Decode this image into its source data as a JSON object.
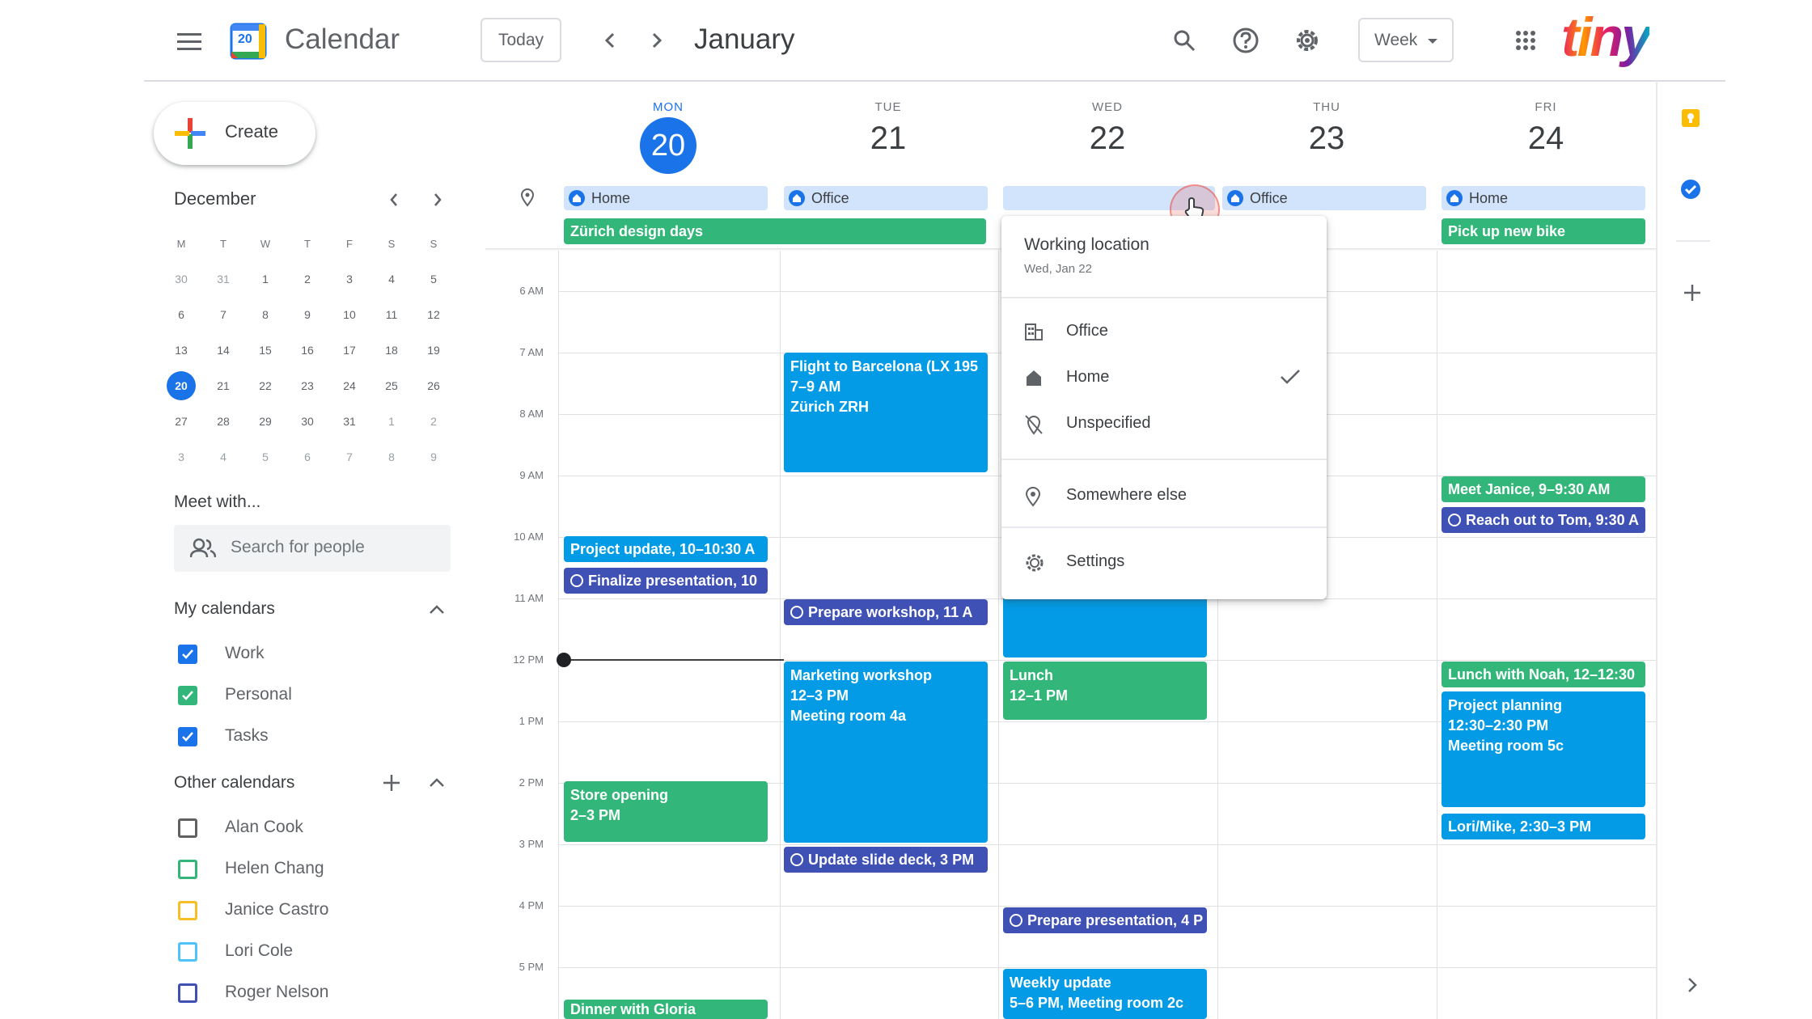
{
  "header": {
    "app_title": "Calendar",
    "logo_day": "20",
    "today_label": "Today",
    "month_title": "January",
    "view_label": "Week",
    "brand_logo": "tiny"
  },
  "sidebar": {
    "create_label": "Create",
    "mini_calendar": {
      "month": "December",
      "weekday_headers": [
        "M",
        "T",
        "W",
        "T",
        "F",
        "S",
        "S"
      ],
      "weeks": [
        [
          "30",
          "31",
          "1",
          "2",
          "3",
          "4",
          "5"
        ],
        [
          "6",
          "7",
          "8",
          "9",
          "10",
          "11",
          "12"
        ],
        [
          "13",
          "14",
          "15",
          "16",
          "17",
          "18",
          "19"
        ],
        [
          "20",
          "21",
          "22",
          "23",
          "24",
          "25",
          "26"
        ],
        [
          "27",
          "28",
          "29",
          "30",
          "31",
          "1",
          "2"
        ],
        [
          "3",
          "4",
          "5",
          "6",
          "7",
          "8",
          "9"
        ]
      ],
      "selected_day": "20"
    },
    "meet_with_title": "Meet with...",
    "search_people_placeholder": "Search for people",
    "my_calendars_title": "My calendars",
    "my_calendars": [
      {
        "name": "Work",
        "color": "#1a73e8",
        "checked": true
      },
      {
        "name": "Personal",
        "color": "#33b679",
        "checked": true
      },
      {
        "name": "Tasks",
        "color": "#1a73e8",
        "checked": true
      }
    ],
    "other_calendars_title": "Other calendars",
    "other_calendars": [
      {
        "name": "Alan Cook",
        "color": "#616161",
        "checked": false
      },
      {
        "name": "Helen Chang",
        "color": "#33b679",
        "checked": false
      },
      {
        "name": "Janice Castro",
        "color": "#f6bf26",
        "checked": false
      },
      {
        "name": "Lori Cole",
        "color": "#4fc3f7",
        "checked": false
      },
      {
        "name": "Roger Nelson",
        "color": "#3f51b5",
        "checked": false
      }
    ]
  },
  "week": {
    "days": [
      {
        "abbr": "MON",
        "num": "20",
        "today": true,
        "location": "Home"
      },
      {
        "abbr": "TUE",
        "num": "21",
        "today": false,
        "location": "Office"
      },
      {
        "abbr": "WED",
        "num": "22",
        "today": false,
        "location": ""
      },
      {
        "abbr": "THU",
        "num": "23",
        "today": false,
        "location": "Office"
      },
      {
        "abbr": "FRI",
        "num": "24",
        "today": false,
        "location": "Home"
      }
    ],
    "all_day_events": [
      {
        "title": "Zürich design days",
        "color": "#33b679"
      },
      {
        "title": "Pick up new bike",
        "color": "#33b679"
      }
    ],
    "time_labels": [
      "6 AM",
      "7 AM",
      "8 AM",
      "9 AM",
      "10 AM",
      "11 AM",
      "12 PM",
      "1 PM",
      "2 PM",
      "3 PM",
      "4 PM",
      "5 PM"
    ],
    "events": {
      "flight": {
        "title": "Flight to Barcelona (LX 195",
        "time": "7–9 AM",
        "place": "Zürich ZRH"
      },
      "project_update": {
        "title": "Project update, 10–10:30 A"
      },
      "finalize_presentation": {
        "title": "Finalize presentation, 10"
      },
      "prepare_workshop": {
        "title": "Prepare workshop, 11 A"
      },
      "marketing_workshop": {
        "title": "Marketing workshop",
        "time": "12–3 PM",
        "place": "Meeting room 4a"
      },
      "lunch": {
        "title": "Lunch",
        "time": "12–1 PM"
      },
      "store_opening": {
        "title": "Store opening",
        "time": "2–3 PM"
      },
      "update_slide_deck": {
        "title": "Update slide deck, 3 PM"
      },
      "prepare_presentation": {
        "title": "Prepare presentation, 4 P"
      },
      "weekly_update": {
        "title": "Weekly update",
        "time": "5–6 PM, Meeting room 2c"
      },
      "dinner": {
        "title": "Dinner with Gloria"
      },
      "meet_janice": {
        "title": "Meet Janice, 9–9:30 AM"
      },
      "reach_out_tom": {
        "title": "Reach out to Tom, 9:30 A"
      },
      "lunch_noah": {
        "title": "Lunch with Noah, 12–12:30"
      },
      "project_planning": {
        "title": "Project planning",
        "time": "12:30–2:30 PM",
        "place": "Meeting room 5c"
      },
      "lori_mike": {
        "title": "Lori/Mike, 2:30–3 PM"
      }
    }
  },
  "popup": {
    "title": "Working location",
    "date": "Wed, Jan 22",
    "options": [
      "Office",
      "Home",
      "Unspecified"
    ],
    "selected": "Home",
    "somewhere_else": "Somewhere else",
    "settings": "Settings"
  },
  "colors": {
    "accent": "#1a73e8",
    "green": "#33b679",
    "blue": "#039be5",
    "indigo": "#3f51b5"
  }
}
